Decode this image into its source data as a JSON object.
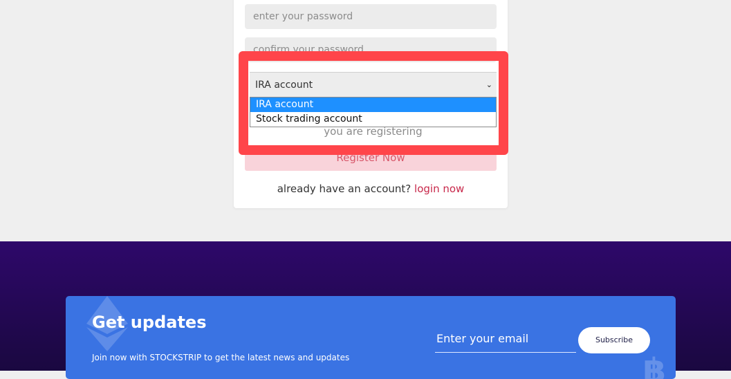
{
  "form": {
    "password_placeholder": "enter your password",
    "confirm_placeholder": "confirm your password",
    "account_select": {
      "selected": "IRA account",
      "options": [
        "IRA account",
        "Stock trading account"
      ]
    },
    "hint": "you are registering",
    "register_label": "Register Now",
    "login_prompt": "already have an account?",
    "login_link": "login now"
  },
  "footer": {
    "title": "Get updates",
    "subtitle": "Join now with STOCKSTRIP to get the latest news and updates",
    "email_placeholder": "Enter your email",
    "subscribe_label": "Subscribe"
  },
  "colors": {
    "highlight": "#ff454a",
    "accent": "#c8284a",
    "footer_bg": "#2e086a",
    "banner_bg": "#3a73e3"
  },
  "icons": [
    "ethereum-icon",
    "bitcoin-icon",
    "chevron-down-icon"
  ]
}
